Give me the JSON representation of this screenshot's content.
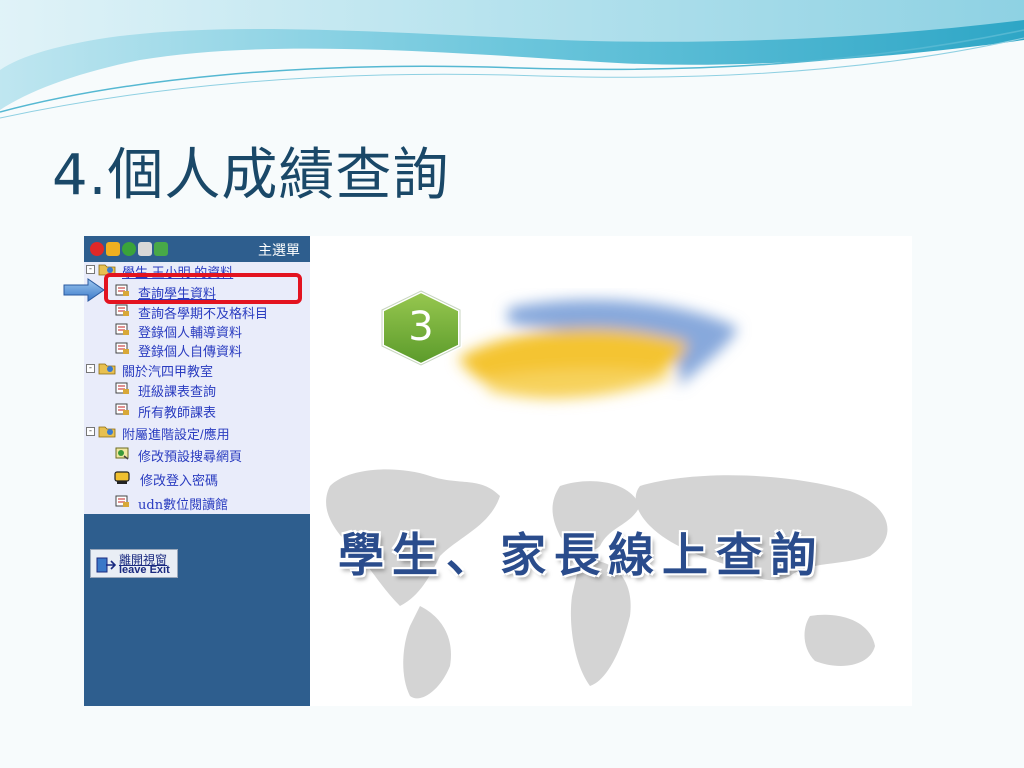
{
  "slide": {
    "title": "4.個人成績查詢"
  },
  "nav": {
    "menu_title": "主選單",
    "toolbar_icons": [
      "close-icon",
      "home-icon",
      "globe-icon",
      "mail-icon",
      "refresh-icon"
    ],
    "tree": [
      {
        "label": "學生 王小明 的資料",
        "type": "group",
        "icon": "folder-icon"
      },
      {
        "label": "查詢學生資料",
        "type": "item",
        "icon": "document-icon",
        "highlighted": true
      },
      {
        "label": "查詢各學期不及格科目",
        "type": "item",
        "icon": "document-icon"
      },
      {
        "label": "登錄個人輔導資料",
        "type": "item",
        "icon": "document-icon"
      },
      {
        "label": "登錄個人自傳資料",
        "type": "item",
        "icon": "document-icon"
      },
      {
        "label": "關於汽四甲教室",
        "type": "group",
        "icon": "folder-icon"
      },
      {
        "label": "班級課表查詢",
        "type": "item",
        "icon": "document-icon"
      },
      {
        "label": "所有教師課表",
        "type": "item",
        "icon": "document-icon"
      },
      {
        "label": "附屬進階設定/應用",
        "type": "group",
        "icon": "folder-icon"
      },
      {
        "label": "修改預設搜尋網頁",
        "type": "item",
        "icon": "settings-icon"
      },
      {
        "label": "修改登入密碼",
        "type": "item",
        "icon": "key-icon"
      },
      {
        "label": "udn數位閱讀館",
        "type": "item",
        "icon": "document-icon"
      }
    ],
    "exit_button": {
      "label_cjk": "離開視窗",
      "label_en": "leave Exit"
    }
  },
  "panel": {
    "step_number": "3",
    "portal_title": "學生、家長線上查詢"
  },
  "colors": {
    "title": "#1a4868",
    "nav_bg": "#2e5e8e",
    "nav_light": "#e9ecfa",
    "link": "#2a3cc0",
    "highlight": "#e31320",
    "step_hex": "#7cb342",
    "portal_title": "#2a4c8c"
  }
}
